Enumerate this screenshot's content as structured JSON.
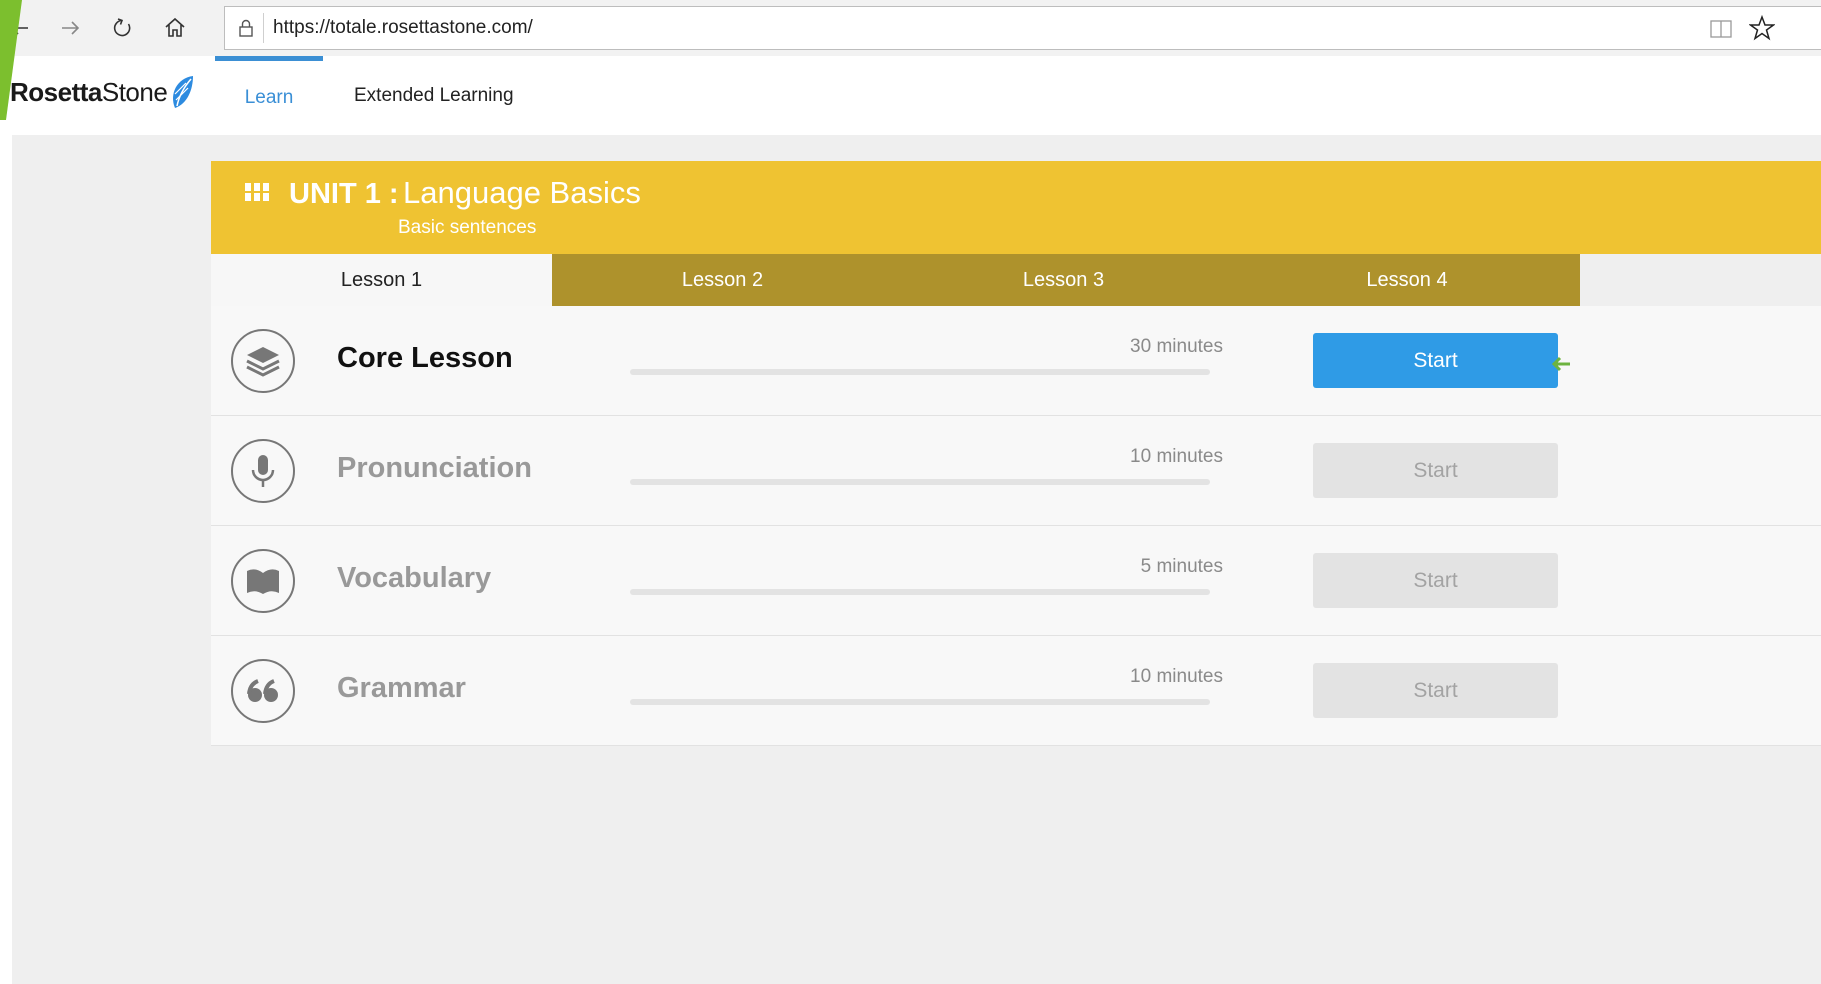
{
  "browser": {
    "url": "https://totale.rosettastone.com/",
    "back_icon": "arrow-left-icon",
    "forward_icon": "arrow-right-icon",
    "refresh_icon": "refresh-icon",
    "home_icon": "home-icon",
    "lock_icon": "lock-icon",
    "reading_icon": "reading-view-icon",
    "favorite_icon": "star-icon"
  },
  "app": {
    "logo": {
      "bold": "Rosetta",
      "regular": "Stone"
    },
    "nav": [
      {
        "label": "Learn",
        "active": true
      },
      {
        "label": "Extended Learning",
        "active": false
      }
    ]
  },
  "unit": {
    "number_label": "UNIT 1 :",
    "name": "Language Basics",
    "subtitle": "Basic sentences",
    "color": "#efc332"
  },
  "lesson_tabs": [
    {
      "label": "Lesson 1",
      "active": true
    },
    {
      "label": "Lesson 2",
      "active": false
    },
    {
      "label": "Lesson 3",
      "active": false
    },
    {
      "label": "Lesson 4",
      "active": false
    }
  ],
  "activities": [
    {
      "title": "Core Lesson",
      "minutes": "30 minutes",
      "button": "Start",
      "enabled": true,
      "icon": "layers-icon",
      "progress": 0
    },
    {
      "title": "Pronunciation",
      "minutes": "10 minutes",
      "button": "Start",
      "enabled": false,
      "icon": "microphone-icon",
      "progress": 0
    },
    {
      "title": "Vocabulary",
      "minutes": "5 minutes",
      "button": "Start",
      "enabled": false,
      "icon": "book-icon",
      "progress": 0
    },
    {
      "title": "Grammar",
      "minutes": "10 minutes",
      "button": "Start",
      "enabled": false,
      "icon": "quote-icon",
      "progress": 0
    }
  ],
  "colors": {
    "accent_blue": "#2f9be6",
    "tab_gold": "#ae922c",
    "disabled_button": "#e3e3e3"
  }
}
